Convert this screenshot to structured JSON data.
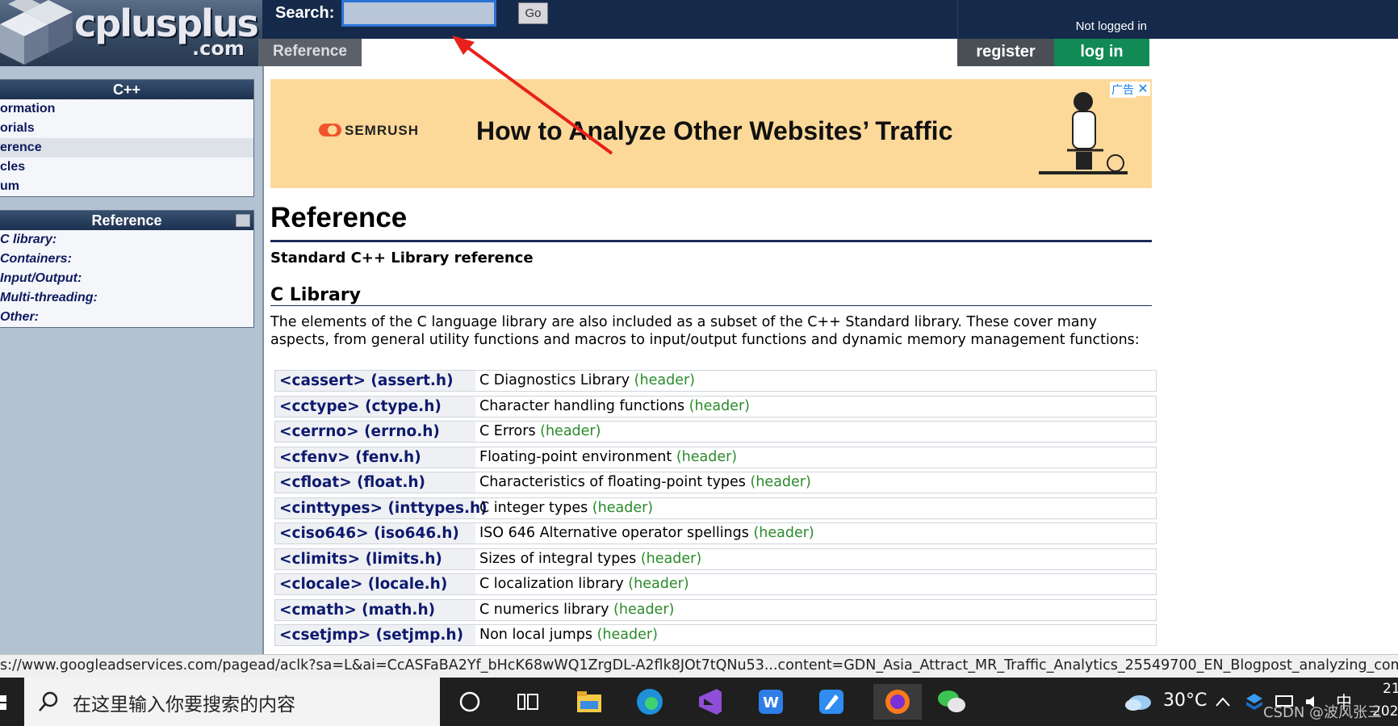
{
  "header": {
    "logo_text": "cplusplus",
    "logo_domain": ".com",
    "search_label": "Search:",
    "search_value": "",
    "go_label": "Go",
    "not_logged": "Not logged in",
    "tab_reference": "Reference",
    "register_label": "register",
    "login_label": "log in"
  },
  "sidebar": {
    "cpp_panel": {
      "title": "C++",
      "items": [
        "ormation",
        "orials",
        "erence",
        "cles",
        "um"
      ]
    },
    "ref_panel": {
      "title": "Reference",
      "items": [
        "C library:",
        "Containers:",
        "Input/Output:",
        "Multi-threading:",
        "Other:"
      ]
    }
  },
  "ad": {
    "brand": "SEMRUSH",
    "title": "How to Analyze Other Websites’ Traffic",
    "badge": "广告",
    "close": "✕"
  },
  "main": {
    "title": "Reference",
    "subtitle": "Standard C++ Library reference",
    "section_title": "C Library",
    "description": "The elements of the C language library are also included as a subset of the C++ Standard library. These cover many aspects, from general utility functions and macros to input/output functions and dynamic memory management functions:",
    "libraries": [
      {
        "name": "<cassert> (assert.h)",
        "desc": "C Diagnostics Library",
        "tag": "(header)"
      },
      {
        "name": "<cctype> (ctype.h)",
        "desc": "Character handling functions",
        "tag": "(header)"
      },
      {
        "name": "<cerrno> (errno.h)",
        "desc": "C Errors",
        "tag": "(header)"
      },
      {
        "name": "<cfenv> (fenv.h)",
        "desc": "Floating-point environment",
        "tag": "(header)"
      },
      {
        "name": "<cfloat> (float.h)",
        "desc": "Characteristics of floating-point types",
        "tag": "(header)"
      },
      {
        "name": "<cinttypes> (inttypes.h)",
        "desc": "C integer types",
        "tag": "(header)"
      },
      {
        "name": "<ciso646> (iso646.h)",
        "desc": "ISO 646 Alternative operator spellings",
        "tag": "(header)"
      },
      {
        "name": "<climits> (limits.h)",
        "desc": "Sizes of integral types",
        "tag": "(header)"
      },
      {
        "name": "<clocale> (locale.h)",
        "desc": "C localization library",
        "tag": "(header)"
      },
      {
        "name": "<cmath> (math.h)",
        "desc": "C numerics library",
        "tag": "(header)"
      },
      {
        "name": "<csetjmp> (setjmp.h)",
        "desc": "Non local jumps",
        "tag": "(header)"
      }
    ]
  },
  "statusbar": {
    "url": "s://www.googleadservices.com/pagead/aclk?sa=L&ai=CcASFaBA2Yf_bHcK68wWQ1ZrgDL-A2flk8JOt7tQNu53...content=GDN_Asia_Attract_MR_Traffic_Analytics_25549700_EN_Blogpost_analyzing_comp"
  },
  "taskbar": {
    "search_placeholder": "在这里输入你要搜索的内容",
    "temperature": "30°C",
    "ime": "中",
    "clock_partial": "21",
    "year_partial": "202",
    "watermark": "CSDN @波风张三"
  },
  "colors": {
    "topbar": "#15294a",
    "login_green": "#128a55",
    "header_tag": "#2a8a2a",
    "link_navy": "#0e1a6e",
    "ad_bg": "#fcd999",
    "annotation_arrow": "#e8201a"
  }
}
